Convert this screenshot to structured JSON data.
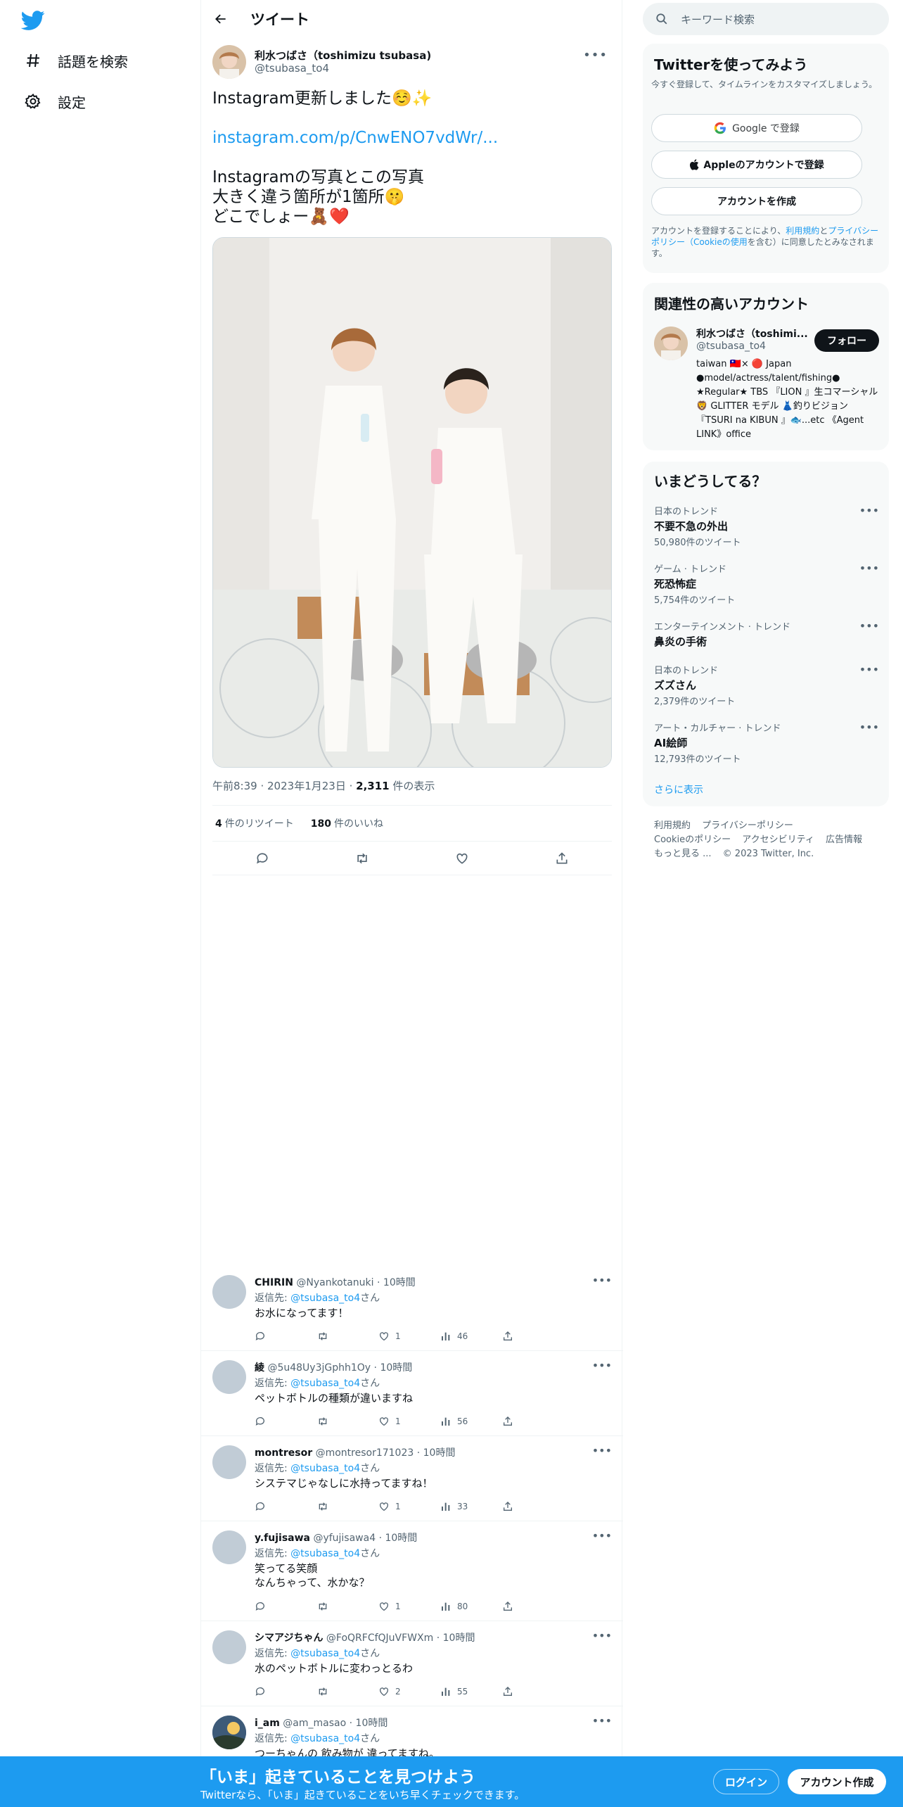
{
  "nav": {
    "explore_label": "話題を検索",
    "settings_label": "設定"
  },
  "header": {
    "title": "ツイート"
  },
  "tweet": {
    "author_name": "利水つばさ（toshimizu tsubasa)",
    "author_handle": "@tsubasa_to4",
    "text_line1": "Instagram更新しました☺️✨",
    "link": "instagram.com/p/CnwENO7vdWr/...",
    "text_line3": "Instagramの写真とこの写真",
    "text_line4": "大きく違う箇所が1箇所🤫",
    "text_line5": "どこでしょー🧸❤️",
    "time": "午前8:39",
    "date": "2023年1月23日",
    "views": "2,311",
    "views_label": "件の表示",
    "retweets": "4",
    "retweets_label": "件のリツイート",
    "likes": "180",
    "likes_label": "件のいいね"
  },
  "replies": [
    {
      "name": "CHIRIN",
      "handle": "@Nyankotanuki",
      "time": "10時間",
      "reply_to_prefix": "返信先: ",
      "reply_to": "@tsubasa_to4",
      "reply_to_suffix": "さん",
      "text": "お水になってます！",
      "likes": "1",
      "views": "46"
    },
    {
      "name": "綾",
      "handle": "@5u48Uy3jGphh1Oy",
      "time": "10時間",
      "reply_to_prefix": "返信先: ",
      "reply_to": "@tsubasa_to4",
      "reply_to_suffix": "さん",
      "text": "ペットボトルの種類が違いますね",
      "likes": "1",
      "views": "56"
    },
    {
      "name": "montresor",
      "handle": "@montresor171023",
      "time": "10時間",
      "reply_to_prefix": "返信先: ",
      "reply_to": "@tsubasa_to4",
      "reply_to_suffix": "さん",
      "text": "システマじゃなしに水持ってますね！",
      "likes": "1",
      "views": "33"
    },
    {
      "name": "y.fujisawa",
      "handle": "@yfujisawa4",
      "time": "10時間",
      "reply_to_prefix": "返信先: ",
      "reply_to": "@tsubasa_to4",
      "reply_to_suffix": "さん",
      "text": "笑ってる笑顔",
      "text2": "なんちゃって、水かな？",
      "likes": "1",
      "views": "80"
    },
    {
      "name": "シマアジちゃん",
      "handle": "@FoQRFCfQJuVFWXm",
      "time": "10時間",
      "reply_to_prefix": "返信先: ",
      "reply_to": "@tsubasa_to4",
      "reply_to_suffix": "さん",
      "text": "水のペットボトルに変わっとるわ",
      "likes": "2",
      "views": "55"
    },
    {
      "name": "i_am",
      "handle": "@am_masao",
      "time": "10時間",
      "reply_to_prefix": "返信先: ",
      "reply_to": "@tsubasa_to4",
      "reply_to_suffix": "さん",
      "text": "つーちゃんの 飲み物が 違ってますね。"
    }
  ],
  "search": {
    "placeholder": "キーワード検索"
  },
  "signup_card": {
    "title": "Twitterを使ってみよう",
    "subtitle": "今すぐ登録して、タイムラインをカスタマイズしましょう。",
    "google_label": "Google で登録",
    "apple_label": "Appleのアカウントで登録",
    "create_label": "アカウントを作成",
    "legal_pre": "アカウントを登録することにより、",
    "legal_terms": "利用規約",
    "legal_and": "と",
    "legal_privacy": "プライバシーポリシー",
    "legal_cookie": "（Cookieの使用",
    "legal_post": "を含む）に同意したとみなされます。"
  },
  "related": {
    "title": "関連性の高いアカウント",
    "name": "利水つばさ（toshimi...",
    "handle": "@tsubasa_to4",
    "follow_label": "フォロー",
    "bio": "taiwan 🇹🇼× 🔴 Japan ●model/actress/talent/fishing● ★Regular★ TBS 『LION 』生コマーシャル🦁 GLITTER モデル 👗釣りビジョン『TSURI na KIBUN 』🐟...etc 《Agent LINK》office"
  },
  "trends": {
    "title": "いまどうしてる？",
    "items": [
      {
        "category": "日本のトレンド",
        "name": "不要不急の外出",
        "count": "50,980件のツイート"
      },
      {
        "category": "ゲーム · トレンド",
        "name": "死恐怖症",
        "count": "5,754件のツイート"
      },
      {
        "category": "エンターテインメント · トレンド",
        "name": "鼻炎の手術",
        "count": ""
      },
      {
        "category": "日本のトレンド",
        "name": "ズズさん",
        "count": "2,379件のツイート"
      },
      {
        "category": "アート・カルチャー · トレンド",
        "name": "AI絵師",
        "count": "12,793件のツイート"
      }
    ],
    "show_more": "さらに表示"
  },
  "footer": {
    "terms": "利用規約",
    "privacy": "プライバシーポリシー",
    "cookie": "Cookieのポリシー",
    "accessibility": "アクセシビリティ",
    "ads": "広告情報",
    "more": "もっと見る ...",
    "copyright": "© 2023 Twitter, Inc."
  },
  "bottombar": {
    "headline": "「いま」起きていることを見つけよう",
    "sub": "Twitterなら、「いま」起きていることをいち早くチェックできます。",
    "login_label": "ログイン",
    "signup_label": "アカウント作成"
  },
  "colors": {
    "accent": "#1d9bf0",
    "text": "#0f1419",
    "muted": "#536471"
  }
}
